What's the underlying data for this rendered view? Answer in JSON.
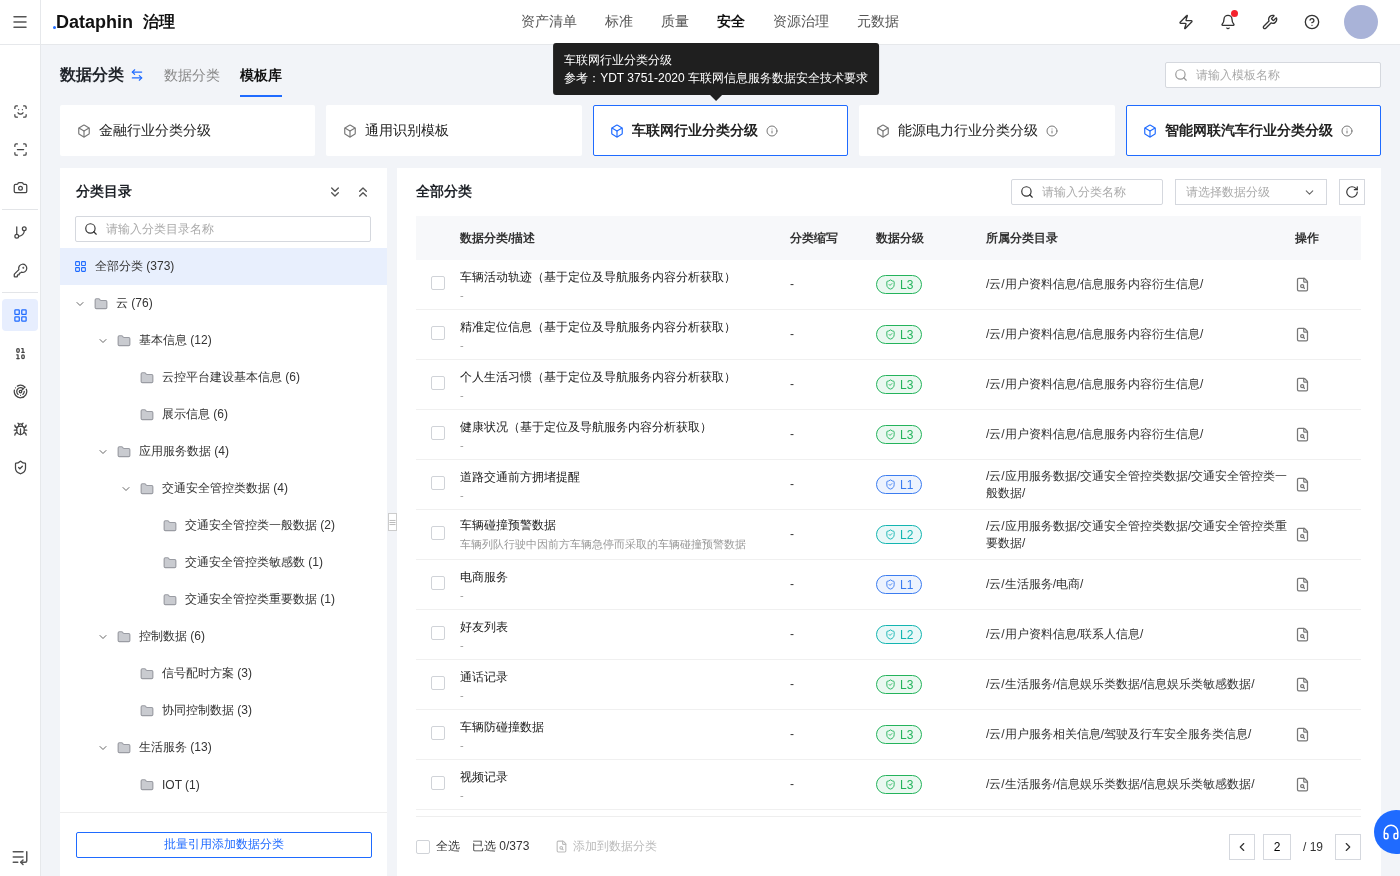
{
  "topbar": {
    "brand": "Dataphin",
    "module": "治理",
    "notification": true,
    "nav": [
      {
        "label": "资产清单",
        "selected": false
      },
      {
        "label": "标准",
        "selected": false
      },
      {
        "label": "质量",
        "selected": false
      },
      {
        "label": "安全",
        "selected": true
      },
      {
        "label": "资源治理",
        "selected": false
      },
      {
        "label": "元数据",
        "selected": false
      }
    ]
  },
  "rail_groups": [
    [
      {
        "selected": false
      },
      {
        "selected": false
      },
      {
        "selected": false
      }
    ],
    [
      {
        "selected": false
      },
      {
        "selected": false
      }
    ],
    [
      {
        "selected": true
      },
      {
        "selected": false
      },
      {
        "selected": false
      },
      {
        "selected": false
      },
      {
        "selected": false
      }
    ]
  ],
  "page": {
    "title": "数据分类",
    "tabs": [
      {
        "label": "数据分类",
        "selected": false
      },
      {
        "label": "模板库",
        "selected": true
      }
    ],
    "search": {
      "placeholder": "请输入模板名称"
    }
  },
  "templates": [
    {
      "name": "金融行业分类分级",
      "selected": false,
      "info": false
    },
    {
      "name": "通用识别模板",
      "selected": false,
      "info": false
    },
    {
      "name": "车联网行业分类分级",
      "selected": true,
      "info": true,
      "tooltip": {
        "title": "车联网行业分类分级",
        "text": "参考：YDT 3751-2020 车联网信息服务数据安全技术要求"
      }
    },
    {
      "name": "能源电力行业分类分级",
      "selected": false,
      "info": true
    },
    {
      "name": "智能网联汽车行业分类分级",
      "selected": true,
      "info": true
    }
  ],
  "directory": {
    "title": "分类目录",
    "search": {
      "placeholder": "请输入分类目录名称"
    },
    "root": {
      "label": "全部分类 (373)",
      "selected": true
    },
    "tree": [
      {
        "label": "云 (76)",
        "expanded": true,
        "children": [
          {
            "label": "基本信息 (12)",
            "expanded": true,
            "children": [
              {
                "label": "云控平台建设基本信息 (6)"
              },
              {
                "label": "展示信息 (6)"
              }
            ]
          },
          {
            "label": "应用服务数据 (4)",
            "expanded": true,
            "children": [
              {
                "label": "交通安全管控类数据 (4)",
                "expanded": true,
                "children": [
                  {
                    "label": "交通安全管控类一般数据 (2)"
                  },
                  {
                    "label": "交通安全管控类敏感数 (1)"
                  },
                  {
                    "label": "交通安全管控类重要数据 (1)"
                  }
                ]
              }
            ]
          },
          {
            "label": "控制数据 (6)",
            "expanded": true,
            "children": [
              {
                "label": "信号配时方案 (3)"
              },
              {
                "label": "协同控制数据 (3)"
              }
            ]
          },
          {
            "label": "生活服务 (13)",
            "expanded": true,
            "children": [
              {
                "label": "IOT (1)"
              }
            ]
          }
        ]
      }
    ],
    "footer_button": "批量引用添加数据分类"
  },
  "table": {
    "title": "全部分类",
    "search": {
      "placeholder": "请输入分类名称"
    },
    "grade_select": {
      "placeholder": "请选择数据分级"
    },
    "columns": [
      "数据分类/描述",
      "分类缩写",
      "数据分级",
      "所属分类目录",
      "操作"
    ],
    "rows": [
      {
        "checked": false,
        "name": "车辆活动轨迹（基于定位及导航服务内容分析获取）",
        "description": "-",
        "abbr": "-",
        "grade": "L3",
        "color": "#23b35b",
        "path": "/云/用户资料信息/信息服务内容衍生信息/"
      },
      {
        "checked": false,
        "name": "精准定位信息（基于定位及导航服务内容分析获取）",
        "description": "-",
        "abbr": "-",
        "grade": "L3",
        "color": "#23b35b",
        "path": "/云/用户资料信息/信息服务内容衍生信息/"
      },
      {
        "checked": false,
        "name": "个人生活习惯（基于定位及导航服务内容分析获取）",
        "description": "-",
        "abbr": "-",
        "grade": "L3",
        "color": "#23b35b",
        "path": "/云/用户资料信息/信息服务内容衍生信息/"
      },
      {
        "checked": false,
        "name": "健康状况（基于定位及导航服务内容分析获取）",
        "description": "-",
        "abbr": "-",
        "grade": "L3",
        "color": "#23b35b",
        "path": "/云/用户资料信息/信息服务内容衍生信息/"
      },
      {
        "checked": false,
        "name": "道路交通前方拥堵提醒",
        "description": "-",
        "abbr": "-",
        "grade": "L1",
        "color": "#3b7cf0",
        "path": "/云/应用服务数据/交通安全管控类数据/交通安全管控类一般数据/"
      },
      {
        "checked": false,
        "name": "车辆碰撞预警数据",
        "description": "车辆列队行驶中因前方车辆急停而采取的车辆碰撞预警数据",
        "abbr": "-",
        "grade": "L2",
        "color": "#13b5b1",
        "path": "/云/应用服务数据/交通安全管控类数据/交通安全管控类重要数据/"
      },
      {
        "checked": false,
        "name": "电商服务",
        "description": "-",
        "abbr": "-",
        "grade": "L1",
        "color": "#3b7cf0",
        "path": "/云/生活服务/电商/"
      },
      {
        "checked": false,
        "name": "好友列表",
        "description": "-",
        "abbr": "-",
        "grade": "L2",
        "color": "#13b5b1",
        "path": "/云/用户资料信息/联系人信息/"
      },
      {
        "checked": false,
        "name": "通话记录",
        "description": "-",
        "abbr": "-",
        "grade": "L3",
        "color": "#23b35b",
        "path": "/云/生活服务/信息娱乐类数据/信息娱乐类敏感数据/"
      },
      {
        "checked": false,
        "name": "车辆防碰撞数据",
        "description": "-",
        "abbr": "-",
        "grade": "L3",
        "color": "#23b35b",
        "path": "/云/用户服务相关信息/驾驶及行车安全服务类信息/"
      },
      {
        "checked": false,
        "name": "视频记录",
        "description": "-",
        "abbr": "-",
        "grade": "L3",
        "color": "#23b35b",
        "path": "/云/生活服务/信息娱乐类数据/信息娱乐类敏感数据/"
      }
    ],
    "footer": {
      "select_all": {
        "label": "全选",
        "checked": false
      },
      "selected_count": "已选 0/373",
      "add_button": {
        "label": "添加到数据分类",
        "disabled": true
      }
    },
    "pagination": {
      "page": "2",
      "total": "/ 19"
    }
  }
}
